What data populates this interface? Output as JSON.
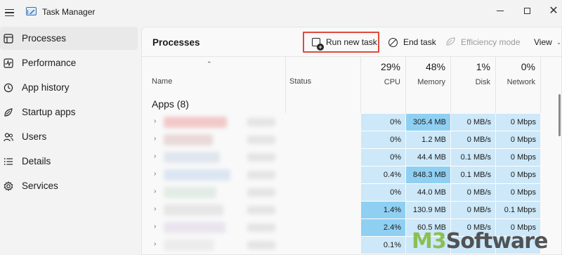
{
  "window": {
    "title": "Task Manager",
    "minimize_icon": "minimize-icon",
    "maximize_icon": "maximize-icon",
    "close_icon": "close-icon"
  },
  "sidebar": {
    "items": [
      {
        "label": "Processes",
        "icon": "processes-icon",
        "active": true
      },
      {
        "label": "Performance",
        "icon": "performance-icon",
        "active": false
      },
      {
        "label": "App history",
        "icon": "app-history-icon",
        "active": false
      },
      {
        "label": "Startup apps",
        "icon": "startup-apps-icon",
        "active": false
      },
      {
        "label": "Users",
        "icon": "users-icon",
        "active": false
      },
      {
        "label": "Details",
        "icon": "details-icon",
        "active": false
      },
      {
        "label": "Services",
        "icon": "services-icon",
        "active": false
      }
    ]
  },
  "toolbar": {
    "page_title": "Processes",
    "run_new_task": "Run new task",
    "end_task": "End task",
    "efficiency_mode": "Efficiency mode",
    "view": "View"
  },
  "columns": {
    "name": "Name",
    "status": "Status",
    "cpu": {
      "percent": "29%",
      "label": "CPU"
    },
    "memory": {
      "percent": "48%",
      "label": "Memory"
    },
    "disk": {
      "percent": "1%",
      "label": "Disk"
    },
    "network": {
      "percent": "0%",
      "label": "Network"
    }
  },
  "group": {
    "label": "Apps (8)"
  },
  "rows": [
    {
      "cpu": "0%",
      "memory": "305.4 MB",
      "disk": "0 MB/s",
      "network": "0 Mbps",
      "cpu_hl": false,
      "mem_hl": true
    },
    {
      "cpu": "0%",
      "memory": "1.2 MB",
      "disk": "0 MB/s",
      "network": "0 Mbps",
      "cpu_hl": false,
      "mem_hl": false
    },
    {
      "cpu": "0%",
      "memory": "44.4 MB",
      "disk": "0.1 MB/s",
      "network": "0 Mbps",
      "cpu_hl": false,
      "mem_hl": false
    },
    {
      "cpu": "0.4%",
      "memory": "848.3 MB",
      "disk": "0.1 MB/s",
      "network": "0 Mbps",
      "cpu_hl": false,
      "mem_hl": true
    },
    {
      "cpu": "0%",
      "memory": "44.0 MB",
      "disk": "0 MB/s",
      "network": "0 Mbps",
      "cpu_hl": false,
      "mem_hl": false
    },
    {
      "cpu": "1.4%",
      "memory": "130.9 MB",
      "disk": "0 MB/s",
      "network": "0.1 Mbps",
      "cpu_hl": true,
      "mem_hl": false
    },
    {
      "cpu": "2.4%",
      "memory": "60.5 MB",
      "disk": "0 MB/s",
      "network": "0 Mbps",
      "cpu_hl": true,
      "mem_hl": false
    },
    {
      "cpu": "0.1%",
      "memory": "",
      "disk": "",
      "network": "",
      "cpu_hl": false,
      "mem_hl": false
    }
  ],
  "colors": {
    "cell_light": "#cde8f8",
    "cell_highlight": "#8fd0f2",
    "accent_outline": "#e2493b"
  },
  "watermark": {
    "part_a": "M3",
    "part_b": "Software"
  }
}
